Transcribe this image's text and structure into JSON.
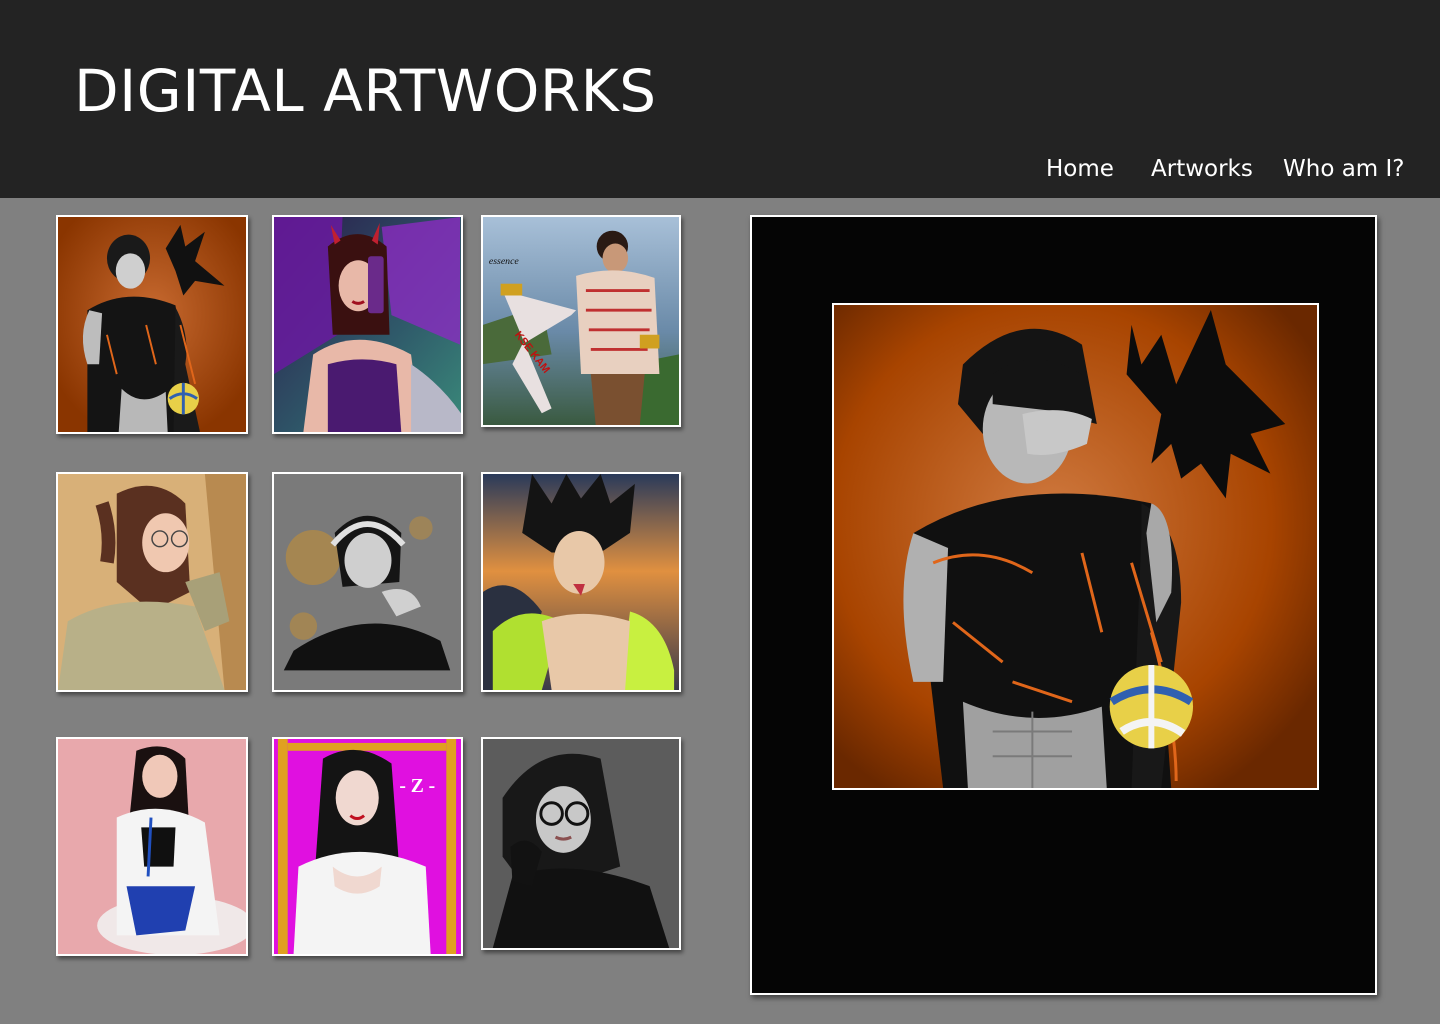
{
  "header": {
    "title": "DIGITAL ARTWORKS",
    "nav": [
      {
        "label": "Home"
      },
      {
        "label": "Artworks"
      },
      {
        "label": "Who am I?"
      }
    ]
  },
  "gallery": {
    "artworks": [
      {
        "subject": "dark-haired man with crow and volleyball on orange background",
        "background_color": "#a84400"
      },
      {
        "subject": "woman with horns and purple wings taking a selfie",
        "background_color": "#2a4a5a"
      },
      {
        "subject": "tattooed warrior holding a sword by the sea",
        "background_color": "#7a9ab8"
      },
      {
        "subject": "woman with glasses and ponytail in olive shirt",
        "background_color": "#c8a070"
      },
      {
        "subject": "man with headphones in black shirt",
        "background_color": "#707070"
      },
      {
        "subject": "spiky-haired anime character at sunset",
        "background_color": "#8a6a5a"
      },
      {
        "subject": "woman in white coat on pink background",
        "background_color": "#e8a8a8"
      },
      {
        "subject": "woman in white blouse on magenta background",
        "background_color": "#e010e0"
      },
      {
        "subject": "woman with round glasses on gray background",
        "background_color": "#5a5a5a"
      }
    ],
    "watermark_text_z": "- Z -",
    "sword_text": "KSE KAM",
    "tag_text": "essence"
  },
  "viewer": {
    "selected_subject": "dark-haired man with crow and volleyball on orange background",
    "frame_color": "#050505"
  }
}
